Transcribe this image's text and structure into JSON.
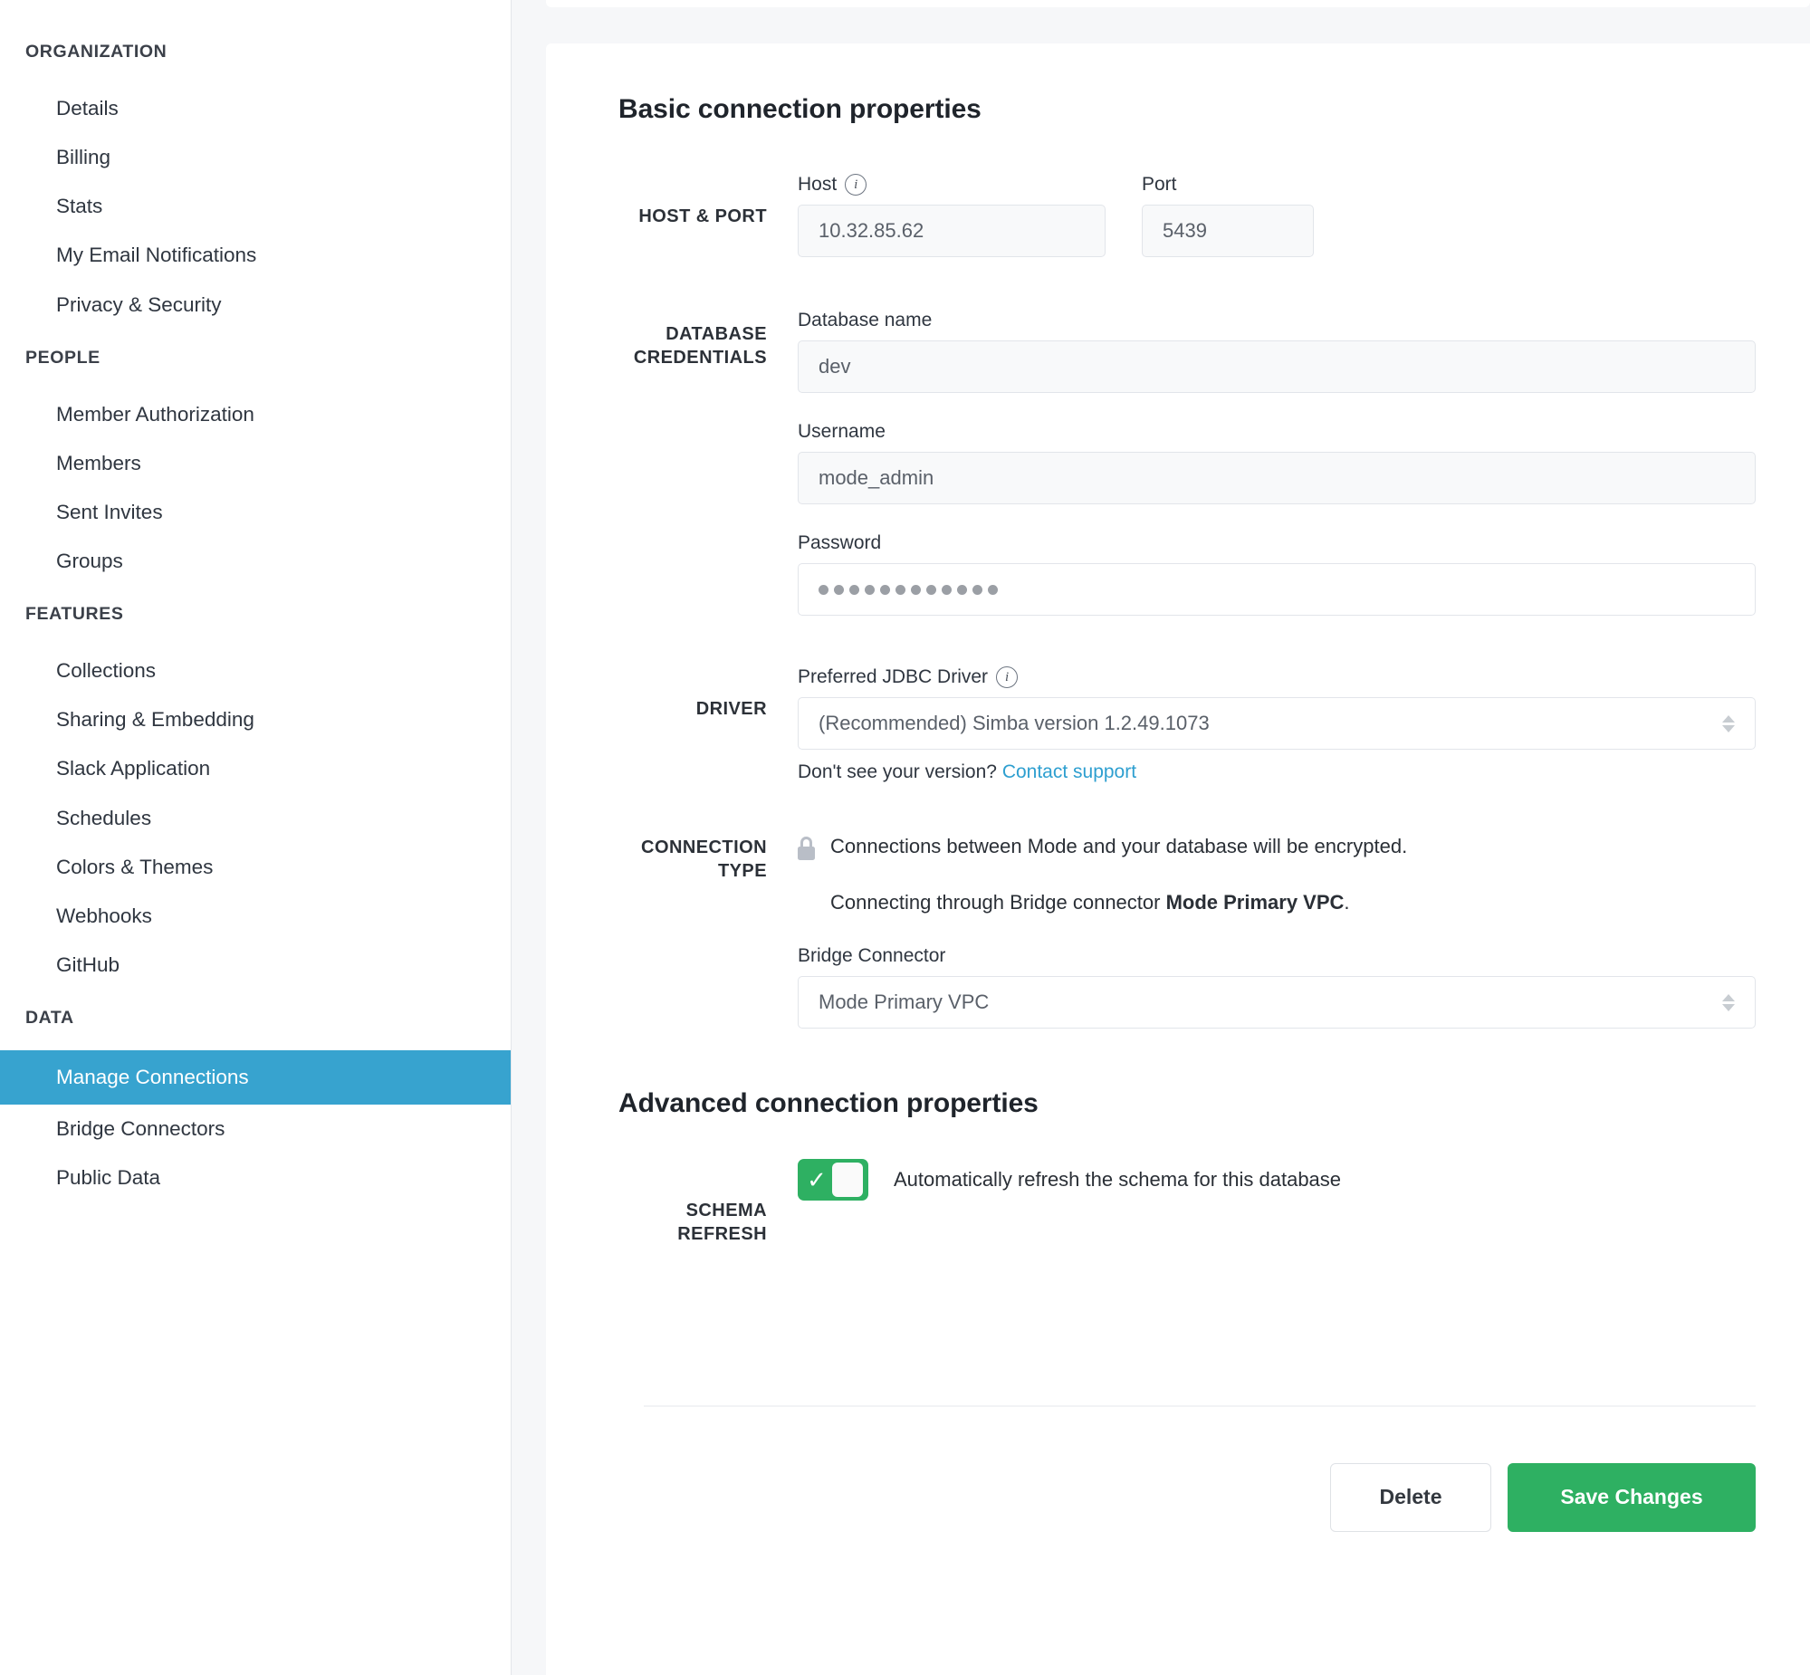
{
  "sidebar": {
    "groups": [
      {
        "heading": "ORGANIZATION",
        "items": [
          {
            "label": "Details",
            "active": false
          },
          {
            "label": "Billing",
            "active": false
          },
          {
            "label": "Stats",
            "active": false
          },
          {
            "label": "My Email Notifications",
            "active": false
          },
          {
            "label": "Privacy & Security",
            "active": false
          }
        ]
      },
      {
        "heading": "PEOPLE",
        "items": [
          {
            "label": "Member Authorization",
            "active": false
          },
          {
            "label": "Members",
            "active": false
          },
          {
            "label": "Sent Invites",
            "active": false
          },
          {
            "label": "Groups",
            "active": false
          }
        ]
      },
      {
        "heading": "FEATURES",
        "items": [
          {
            "label": "Collections",
            "active": false
          },
          {
            "label": "Sharing & Embedding",
            "active": false
          },
          {
            "label": "Slack Application",
            "active": false
          },
          {
            "label": "Schedules",
            "active": false
          },
          {
            "label": "Colors & Themes",
            "active": false
          },
          {
            "label": "Webhooks",
            "active": false
          },
          {
            "label": "GitHub",
            "active": false
          }
        ]
      },
      {
        "heading": "DATA",
        "items": [
          {
            "label": "Manage Connections",
            "active": true
          },
          {
            "label": "Bridge Connectors",
            "active": false
          },
          {
            "label": "Public Data",
            "active": false
          }
        ]
      }
    ],
    "active_color": "#37a3cf"
  },
  "basic": {
    "title": "Basic connection properties",
    "host_port": {
      "row_label": "HOST & PORT",
      "host_label": "Host",
      "host_info_icon": "info-icon",
      "host_value": "10.32.85.62",
      "port_label": "Port",
      "port_value": "5439"
    },
    "credentials": {
      "row_label": "DATABASE\nCREDENTIALS",
      "database_label": "Database name",
      "database_value": "dev",
      "username_label": "Username",
      "username_value": "mode_admin",
      "password_label": "Password",
      "password_dots": 12
    },
    "driver": {
      "row_label": "DRIVER",
      "label": "Preferred JDBC Driver",
      "info_icon": "info-icon",
      "value": "(Recommended) Simba version 1.2.49.1073",
      "helper_text": "Don't see your version?",
      "helper_link": "Contact support",
      "link_color": "#2e9fd0"
    },
    "connection_type": {
      "row_label": "CONNECTION\nTYPE",
      "lock_icon": "lock-icon",
      "encrypted_note": "Connections between Mode and your database will be encrypted.",
      "bridge_note_prefix": "Connecting through Bridge connector ",
      "bridge_note_name": "Mode Primary VPC",
      "bridge_note_suffix": ".",
      "bridge_label": "Bridge Connector",
      "bridge_value": "Mode Primary VPC"
    }
  },
  "advanced": {
    "title": "Advanced connection properties",
    "schema_refresh": {
      "row_label": "SCHEMA\nREFRESH",
      "toggle_state": "on",
      "toggle_color": "#2eb062",
      "toggle_glyph": "✓",
      "description": "Automatically refresh the schema for this database"
    }
  },
  "actions": {
    "delete_label": "Delete",
    "save_label": "Save Changes",
    "save_color": "#2eb062"
  }
}
